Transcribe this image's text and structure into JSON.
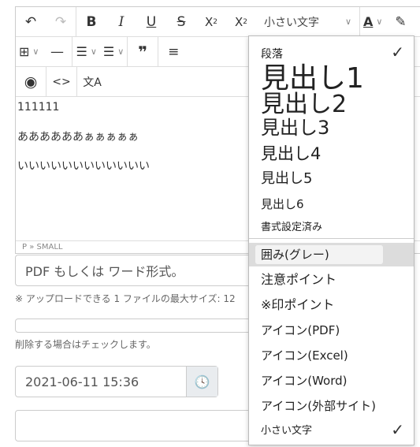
{
  "toolbar": {
    "style_dropdown_label": "小さい文字",
    "font_color_label": "A"
  },
  "editor": {
    "lines": [
      "111111",
      "ああああああぁぁぁぁぁ",
      "いいいいいいいいいいいい"
    ],
    "status_path": "P » SMALL"
  },
  "form": {
    "file_placeholder": "PDF もしくは ワード形式。",
    "upload_help": "※ アップロードできる 1 ファイルの最大サイズ: 12",
    "delete_help": "削除する場合はチェックします。",
    "datetime_value": "2021-06-11 15:36"
  },
  "dropdown": {
    "items": [
      {
        "label": "段落"
      },
      {
        "label": "見出し1"
      },
      {
        "label": "見出し2"
      },
      {
        "label": "見出し3"
      },
      {
        "label": "見出し4"
      },
      {
        "label": "見出し5"
      },
      {
        "label": "見出し6"
      },
      {
        "label": "書式設定済み"
      },
      {
        "label": "囲み(グレー)"
      },
      {
        "label": "注意ポイント"
      },
      {
        "label": "※印ポイント"
      },
      {
        "label": "アイコン(PDF)"
      },
      {
        "label": "アイコン(Excel)"
      },
      {
        "label": "アイコン(Word)"
      },
      {
        "label": "アイコン(外部サイト)"
      },
      {
        "label": "小さい文字"
      }
    ]
  }
}
